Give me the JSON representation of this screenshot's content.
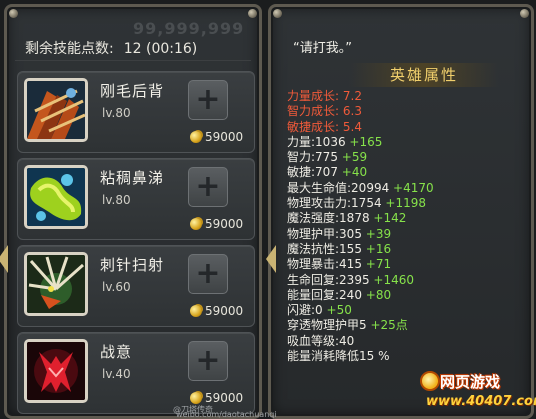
{
  "left_panel": {
    "faded_gold": "99,999,999",
    "remaining_label": "剩余技能点数:",
    "remaining_value": "12 (00:16)",
    "skills": [
      {
        "name": "刚毛后背",
        "level": "lv.80",
        "cost": "59000",
        "icon": "bristleback-back-icon"
      },
      {
        "name": "粘稠鼻涕",
        "level": "lv.80",
        "cost": "59000",
        "icon": "viscous-nasal-goo-icon"
      },
      {
        "name": "刺针扫射",
        "level": "lv.60",
        "cost": "59000",
        "icon": "quill-spray-icon"
      },
      {
        "name": "战意",
        "level": "lv.40",
        "cost": "59000",
        "icon": "warpath-icon"
      }
    ]
  },
  "right_panel": {
    "quote": "“请打我。”",
    "title": "英雄属性",
    "growth": [
      {
        "label": "力量成长:",
        "value": "7.2"
      },
      {
        "label": "智力成长:",
        "value": "6.3"
      },
      {
        "label": "敏捷成长:",
        "value": "5.4"
      }
    ],
    "stats": [
      {
        "label": "力量:1036",
        "bonus": "+165"
      },
      {
        "label": "智力:775",
        "bonus": "+59"
      },
      {
        "label": "敏捷:707",
        "bonus": "+40"
      },
      {
        "label": "最大生命值:20994",
        "bonus": "+4170"
      },
      {
        "label": "物理攻击力:1754",
        "bonus": "+1198"
      },
      {
        "label": "魔法强度:1878",
        "bonus": "+142"
      },
      {
        "label": "物理护甲:305",
        "bonus": "+39"
      },
      {
        "label": "魔法抗性:155",
        "bonus": "+16"
      },
      {
        "label": "物理暴击:415",
        "bonus": "+71"
      },
      {
        "label": "生命回复:2395",
        "bonus": "+1460"
      },
      {
        "label": "能量回复:240",
        "bonus": "+80"
      },
      {
        "label": "闪避:0",
        "bonus": "+50"
      },
      {
        "label": "穿透物理护甲5",
        "bonus": "+25点"
      },
      {
        "label": "吸血等级:40",
        "bonus": ""
      },
      {
        "label": "能量消耗降低15 %",
        "bonus": ""
      }
    ]
  },
  "footer": {
    "weibo_left": "@刀塔传奇",
    "weibo_url": "weibo.com/daotachuanqi",
    "logo_top": "网页游戏",
    "logo_bottom": "www.40407.com"
  },
  "colors": {
    "growth": "#f05a3a",
    "bonus": "#86e24a",
    "title": "#f0cf6c"
  }
}
